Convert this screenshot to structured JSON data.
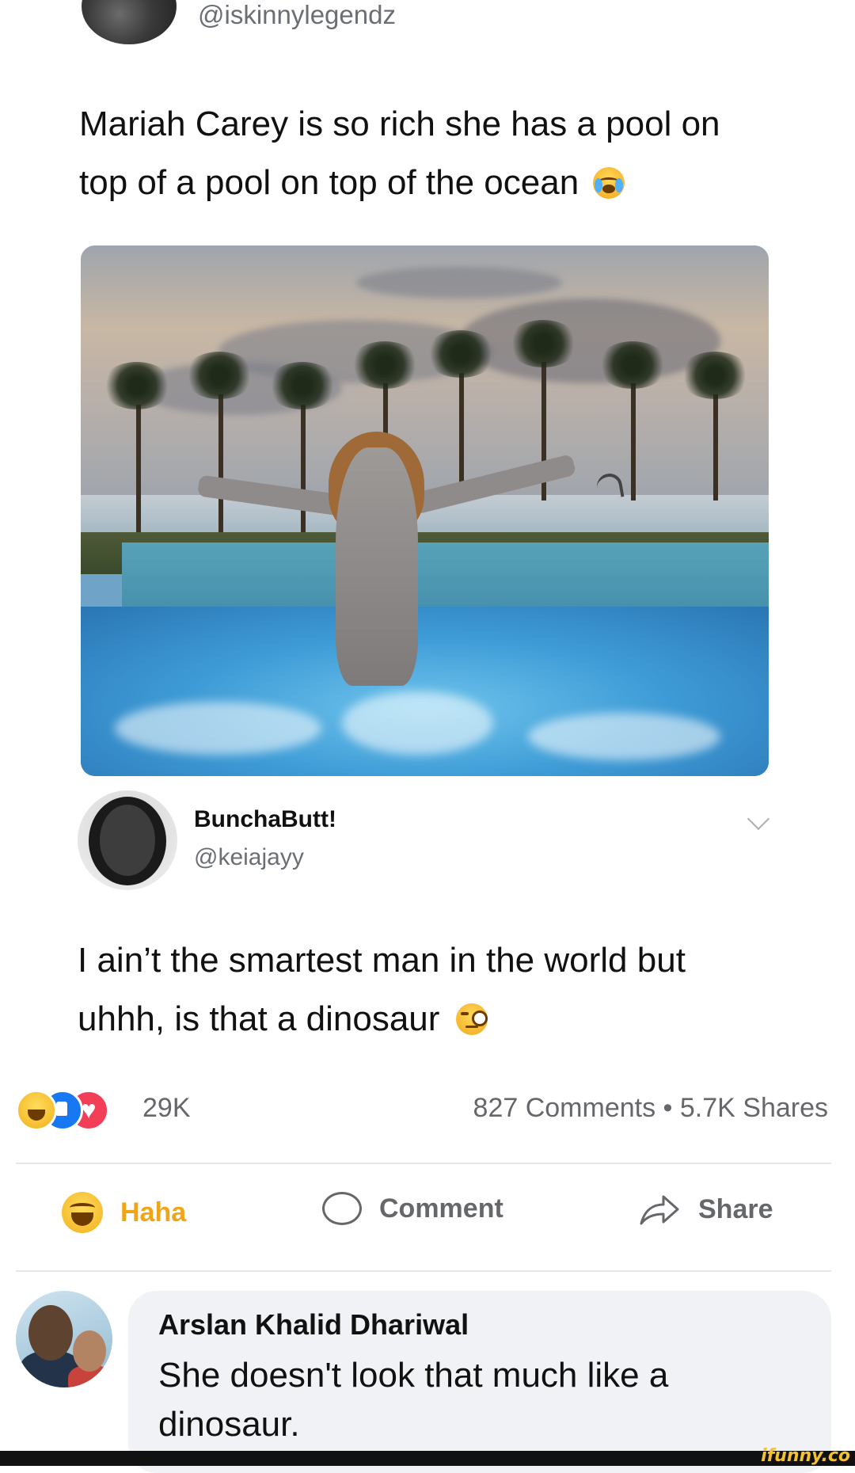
{
  "post": {
    "handle": "@iskinnylegendz",
    "text": "Mariah Carey is so rich she has a pool on top of a pool on top of the ocean",
    "text_emoji": "crying-face-emoji"
  },
  "reply": {
    "name": "BunchaButt!",
    "handle": "@keiajayy",
    "text": "I ain’t the smartest man in the world but uhhh, is that a dinosaur",
    "text_emoji": "face-with-monocle-emoji"
  },
  "stats": {
    "reactions": [
      "haha",
      "like",
      "love"
    ],
    "reaction_count": "29K",
    "comments_shares": "827 Comments • 5.7K Shares"
  },
  "actions": {
    "haha_label": "Haha",
    "comment_label": "Comment",
    "share_label": "Share"
  },
  "comment": {
    "name": "Arslan Khalid Dhariwal",
    "text": "She doesn't look that much like a dinosaur."
  },
  "watermark": "ifunny.co",
  "colors": {
    "haha_active": "#f0a418",
    "like_blue": "#1877f2",
    "love_red": "#f33e58",
    "muted_text": "#65676b"
  }
}
